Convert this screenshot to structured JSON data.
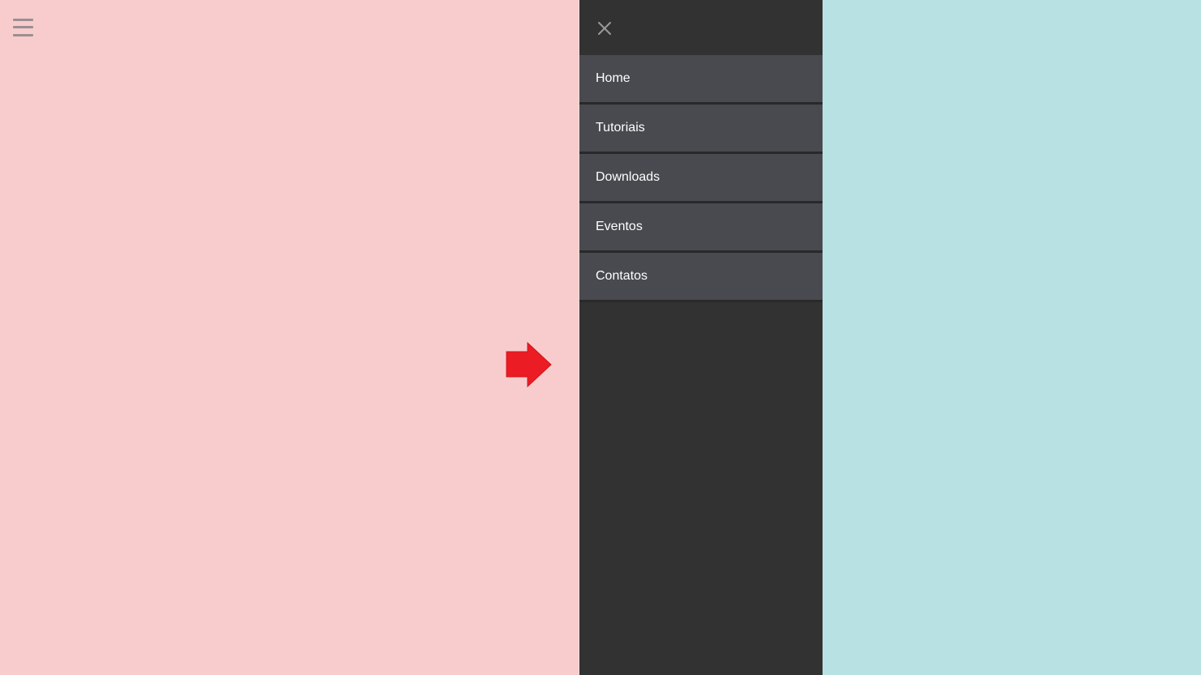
{
  "colors": {
    "left_bg": "#f8cccc",
    "right_bg": "#b8e1e3",
    "drawer_bg": "#323232",
    "menu_item_bg": "#494a4f",
    "menu_text": "#ffffff",
    "icon_gray": "#9a8f90",
    "arrow_red": "#ec1c24"
  },
  "icons": {
    "menu_toggle": "hamburger-icon",
    "close": "close-icon",
    "pointer": "right-arrow-icon"
  },
  "menu": {
    "items": [
      {
        "label": "Home"
      },
      {
        "label": "Tutoriais"
      },
      {
        "label": "Downloads"
      },
      {
        "label": "Eventos"
      },
      {
        "label": "Contatos"
      }
    ]
  }
}
